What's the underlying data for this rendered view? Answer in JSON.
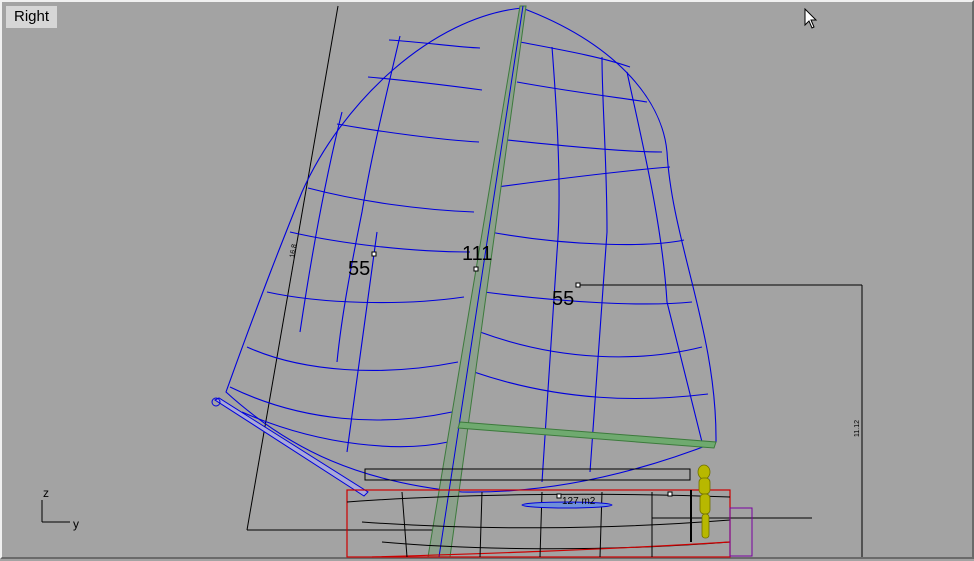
{
  "viewport": {
    "title": "Right",
    "labels": {
      "panel_left": "55",
      "mast": "111",
      "panel_right": "55",
      "area": "127 m2",
      "dim_vertical": "11.12",
      "dim_diagonal": "16.8"
    },
    "axes": {
      "z": "z",
      "y": "y"
    }
  },
  "colors": {
    "background": "#a3a3a3",
    "sail_wireframe": "#0000dd",
    "mast": "#3c7a3c",
    "boom": "#3c7a3c",
    "hull_outline": "#cc0000",
    "deck_edge": "#7a00a0",
    "crew": "#b8b800",
    "dimension": "#000000"
  },
  "icons": {
    "cursor": "arrow-cursor-icon",
    "axis": "axis-triad-icon"
  }
}
